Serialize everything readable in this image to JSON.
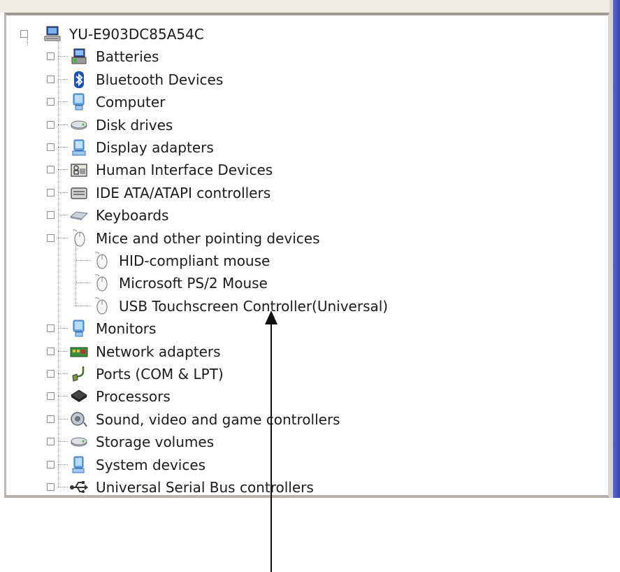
{
  "device_tree": {
    "root": {
      "label": "YU-E903DC85A54C",
      "icon": "computer-icon",
      "expanded": true
    },
    "categories": [
      {
        "label": "Batteries",
        "icon": "battery-icon",
        "expanded": false
      },
      {
        "label": "Bluetooth Devices",
        "icon": "bluetooth-icon",
        "expanded": false
      },
      {
        "label": "Computer",
        "icon": "monitor-icon",
        "expanded": false
      },
      {
        "label": "Disk drives",
        "icon": "disk-drive-icon",
        "expanded": false
      },
      {
        "label": "Display adapters",
        "icon": "display-adapter-icon",
        "expanded": false
      },
      {
        "label": "Human Interface Devices",
        "icon": "hid-icon",
        "expanded": false
      },
      {
        "label": "IDE ATA/ATAPI controllers",
        "icon": "ide-controller-icon",
        "expanded": false
      },
      {
        "label": "Keyboards",
        "icon": "keyboard-icon",
        "expanded": false
      },
      {
        "label": "Mice and other pointing devices",
        "icon": "mouse-icon",
        "expanded": true,
        "children": [
          {
            "label": "HID-compliant mouse",
            "icon": "mouse-icon"
          },
          {
            "label": "Microsoft PS/2 Mouse",
            "icon": "mouse-icon"
          },
          {
            "label": "USB Touchscreen Controller(Universal)",
            "icon": "mouse-icon"
          }
        ]
      },
      {
        "label": "Monitors",
        "icon": "monitor-icon",
        "expanded": false
      },
      {
        "label": "Network adapters",
        "icon": "network-adapter-icon",
        "expanded": false
      },
      {
        "label": "Ports (COM & LPT)",
        "icon": "port-icon",
        "expanded": false
      },
      {
        "label": "Processors",
        "icon": "processor-icon",
        "expanded": false
      },
      {
        "label": "Sound, video and game controllers",
        "icon": "sound-icon",
        "expanded": false
      },
      {
        "label": "Storage volumes",
        "icon": "storage-volume-icon",
        "expanded": false
      },
      {
        "label": "System devices",
        "icon": "system-devices-icon",
        "expanded": false
      },
      {
        "label": "Universal Serial Bus controllers",
        "icon": "usb-icon",
        "expanded": false
      }
    ]
  },
  "expander_glyphs": {
    "collapsed": "+",
    "expanded": "−"
  }
}
